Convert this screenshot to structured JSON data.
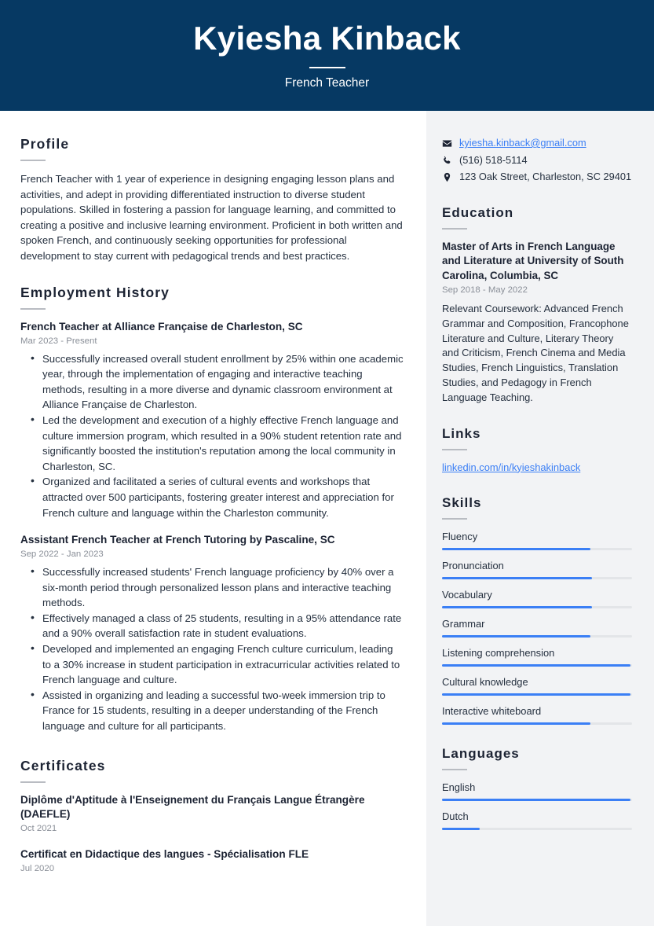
{
  "header": {
    "name": "Kyiesha Kinback",
    "title": "French Teacher"
  },
  "main": {
    "profile": {
      "heading": "Profile",
      "text": "French Teacher with 1 year of experience in designing engaging lesson plans and activities, and adept in providing differentiated instruction to diverse student populations. Skilled in fostering a passion for language learning, and committed to creating a positive and inclusive learning environment. Proficient in both written and spoken French, and continuously seeking opportunities for professional development to stay current with pedagogical trends and best practices."
    },
    "employment": {
      "heading": "Employment History",
      "jobs": [
        {
          "title": "French Teacher at Alliance Française de Charleston, SC",
          "date": "Mar 2023 - Present",
          "bullets": [
            "Successfully increased overall student enrollment by 25% within one academic year, through the implementation of engaging and interactive teaching methods, resulting in a more diverse and dynamic classroom environment at Alliance Française de Charleston.",
            "Led the development and execution of a highly effective French language and culture immersion program, which resulted in a 90% student retention rate and significantly boosted the institution's reputation among the local community in Charleston, SC.",
            "Organized and facilitated a series of cultural events and workshops that attracted over 500 participants, fostering greater interest and appreciation for French culture and language within the Charleston community."
          ]
        },
        {
          "title": "Assistant French Teacher at French Tutoring by Pascaline, SC",
          "date": "Sep 2022 - Jan 2023",
          "bullets": [
            "Successfully increased students' French language proficiency by 40% over a six-month period through personalized lesson plans and interactive teaching methods.",
            "Effectively managed a class of 25 students, resulting in a 95% attendance rate and a 90% overall satisfaction rate in student evaluations.",
            "Developed and implemented an engaging French culture curriculum, leading to a 30% increase in student participation in extracurricular activities related to French language and culture.",
            "Assisted in organizing and leading a successful two-week immersion trip to France for 15 students, resulting in a deeper understanding of the French language and culture for all participants."
          ]
        }
      ]
    },
    "certificates": {
      "heading": "Certificates",
      "items": [
        {
          "title": "Diplôme d'Aptitude à l'Enseignement du Français Langue Étrangère (DAEFLE)",
          "date": "Oct 2021"
        },
        {
          "title": "Certificat en Didactique des langues - Spécialisation FLE",
          "date": "Jul 2020"
        }
      ]
    }
  },
  "sidebar": {
    "contact": [
      {
        "icon": "envelope-icon",
        "value": "kyiesha.kinback@gmail.com",
        "is_link": true
      },
      {
        "icon": "phone-icon",
        "value": "(516) 518-5114",
        "is_link": false
      },
      {
        "icon": "location-pin-icon",
        "value": "123 Oak Street, Charleston, SC 29401",
        "is_link": false
      }
    ],
    "education": {
      "heading": "Education",
      "degree": "Master of Arts in French Language and Literature at University of South Carolina, Columbia, SC",
      "date": "Sep 2018 - May 2022",
      "description": "Relevant Coursework: Advanced French Grammar and Composition, Francophone Literature and Culture, Literary Theory and Criticism, French Cinema and Media Studies, French Linguistics, Translation Studies, and Pedagogy in French Language Teaching."
    },
    "links": {
      "heading": "Links",
      "items": [
        {
          "label": "linkedin.com/in/kyieshakinback"
        }
      ]
    },
    "skills": {
      "heading": "Skills",
      "items": [
        {
          "label": "Fluency",
          "level": 78
        },
        {
          "label": "Pronunciation",
          "level": 79
        },
        {
          "label": "Vocabulary",
          "level": 79
        },
        {
          "label": "Grammar",
          "level": 78
        },
        {
          "label": "Listening comprehension",
          "level": 99
        },
        {
          "label": "Cultural knowledge",
          "level": 99
        },
        {
          "label": "Interactive whiteboard",
          "level": 78
        }
      ]
    },
    "languages": {
      "heading": "Languages",
      "items": [
        {
          "label": "English",
          "level": 99
        },
        {
          "label": "Dutch",
          "level": 20
        }
      ]
    }
  },
  "colors": {
    "header_background": "#063963",
    "sidebar_background": "#f2f3f5",
    "accent_blue": "#3b7ff5",
    "heading_text": "#1c2333",
    "muted_text": "#8a8f98"
  }
}
